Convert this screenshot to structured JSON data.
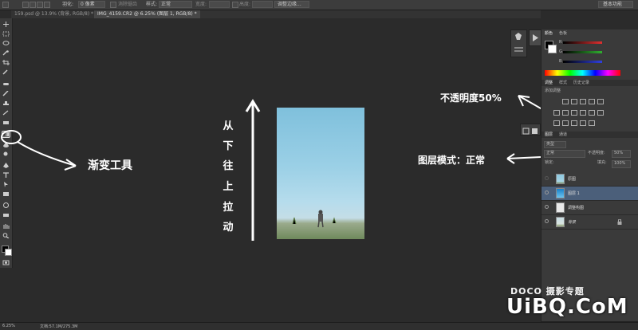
{
  "options_bar": {
    "feather_label": "羽化:",
    "feather_value": "0 像素",
    "antialias_label": "消除锯齿",
    "style_label": "样式:",
    "style_value": "正常",
    "width_label": "宽度:",
    "height_label": "高度:",
    "refine_edge_button": "调整边缘...",
    "workspace_button": "基本功能"
  },
  "doc_tabs": [
    {
      "label": "159.psd @ 13.9% (背景, RGB/8) *"
    },
    {
      "label": "IMG_4159.CR2 @ 6.25% (图层 1, RGB/8) *"
    }
  ],
  "color_panel": {
    "tabs": [
      "颜色",
      "色板"
    ],
    "channels": [
      {
        "name": "R",
        "color": "#e03030"
      },
      {
        "name": "G",
        "color": "#30b030"
      },
      {
        "name": "B",
        "color": "#3040e0"
      }
    ]
  },
  "adjust_panel": {
    "tabs": [
      "调整",
      "样式",
      "历史记录"
    ],
    "title": "添加调整"
  },
  "layers_panel": {
    "tabs": [
      "图层",
      "通道"
    ],
    "kind_label": "类型",
    "blend_mode": "正常",
    "opacity_label": "不透明度:",
    "opacity_value": "50%",
    "lock_label": "锁定:",
    "fill_label": "填充:",
    "fill_value": "100%",
    "layers": [
      {
        "name": "原图"
      },
      {
        "name": "图层 1"
      },
      {
        "name": "调整构图"
      },
      {
        "name": "背景"
      }
    ]
  },
  "annotations": {
    "gradient_tool": "渐变工具",
    "vertical_chars": [
      "从",
      "下",
      "往",
      "上",
      "拉",
      "动"
    ],
    "opacity_note": "不透明度50%",
    "blend_note": "图层模式：正常"
  },
  "status": {
    "zoom": "6.25%",
    "doc_info": "文档:57.1M/275.3M"
  },
  "watermark": {
    "line1": "DOCO 摄影专题",
    "line2": "UiBQ.CoM"
  }
}
